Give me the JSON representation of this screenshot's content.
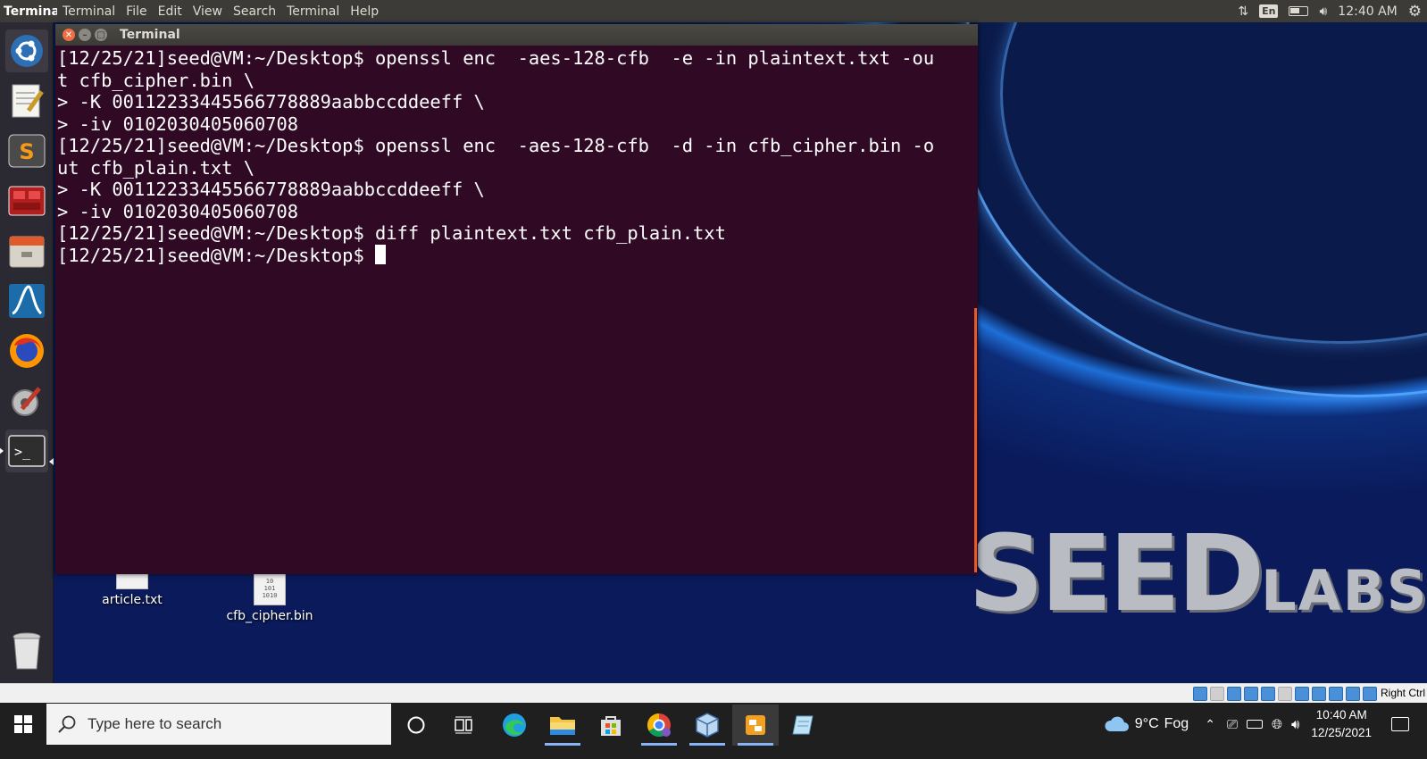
{
  "topbar": {
    "app_name": "Terminal",
    "menus": [
      "Terminal",
      "File",
      "Edit",
      "View",
      "Search",
      "Terminal",
      "Help"
    ],
    "indicators": {
      "keyboard": "En",
      "time": "12:40 AM"
    }
  },
  "launcher": {
    "items": [
      "ubuntu-dash",
      "text-editor",
      "sublime-text",
      "app-red",
      "file-manager",
      "wireshark",
      "firefox",
      "system-settings",
      "terminal",
      "trash"
    ]
  },
  "terminal": {
    "title": "Terminal",
    "lines": [
      "[12/25/21]seed@VM:~/Desktop$ openssl enc  -aes-128-cfb  -e -in plaintext.txt -ou",
      "t cfb_cipher.bin \\",
      "> -K 00112233445566778889aabbccddeeff \\",
      "> -iv 0102030405060708",
      "[12/25/21]seed@VM:~/Desktop$ openssl enc  -aes-128-cfb  -d -in cfb_cipher.bin -o",
      "ut cfb_plain.txt \\",
      "> -K 00112233445566778889aabbccddeeff \\",
      "> -iv 0102030405060708",
      "[12/25/21]seed@VM:~/Desktop$ diff plaintext.txt cfb_plain.txt"
    ],
    "prompt": "[12/25/21]seed@VM:~/Desktop$ "
  },
  "desktop": {
    "icons": [
      {
        "label": "article.txt"
      },
      {
        "label": "cfb_cipher.bin",
        "preview": [
          "10",
          "101",
          "1010"
        ]
      }
    ],
    "wallpaper": {
      "brand_big": "SEED",
      "brand_small": "LABS"
    }
  },
  "vbox": {
    "host_key": "Right Ctrl"
  },
  "taskbar": {
    "search_placeholder": "Type here to search",
    "apps": [
      "cortana",
      "task-view",
      "edge",
      "file-explorer",
      "microsoft-store",
      "chrome",
      "virtualbox",
      "virtualbox-vm",
      "notepad"
    ],
    "weather": {
      "temp": "9°C",
      "condition": "Fog"
    },
    "clock": {
      "time": "10:40 AM",
      "date": "12/25/2021"
    }
  },
  "colors": {
    "terminal_bg": "#300a24",
    "topbar_bg": "#3c3b37",
    "launcher_bg": "#2b2a33",
    "taskbar_bg": "#1f1f1f",
    "close_btn": "#ef6e46"
  }
}
